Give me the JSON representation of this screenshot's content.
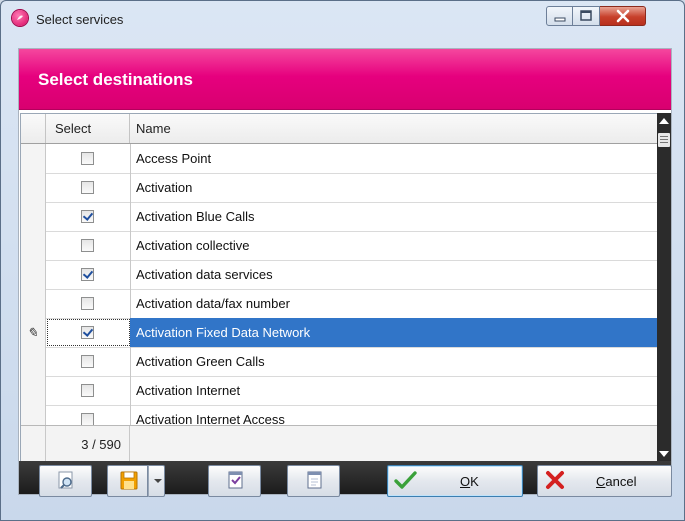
{
  "window": {
    "title": "Select services",
    "controls": {
      "minimize": "minimize",
      "maximize": "maximize",
      "close": "close"
    }
  },
  "header": {
    "title": "Select destinations"
  },
  "grid": {
    "columns": [
      "Select",
      "Name"
    ],
    "rows": [
      {
        "checked": false,
        "name": "Access Point"
      },
      {
        "checked": false,
        "name": "Activation"
      },
      {
        "checked": true,
        "name": "Activation Blue Calls"
      },
      {
        "checked": false,
        "name": "Activation collective"
      },
      {
        "checked": true,
        "name": "Activation data services"
      },
      {
        "checked": false,
        "name": "Activation data/fax number"
      },
      {
        "checked": true,
        "name": "Activation Fixed Data Network",
        "selected": true,
        "editing": true
      },
      {
        "checked": false,
        "name": "Activation Green Calls"
      },
      {
        "checked": false,
        "name": "Activation Internet"
      },
      {
        "checked": false,
        "name": "Activation Internet Access"
      }
    ],
    "footer_count": "3 / 590",
    "edit_indicator": "✎"
  },
  "toolbar": {
    "ok_label": "OK",
    "ok_underline": "O",
    "ok_rest": "K",
    "cancel_label": "Cancel",
    "cancel_underline": "C",
    "cancel_rest": "ancel"
  },
  "colors": {
    "header_pink": "#e6007e",
    "selection_blue": "#3175c8",
    "save_icon_orange": "#f2a000",
    "ok_green": "#3aa13a",
    "cancel_red": "#d42020"
  }
}
